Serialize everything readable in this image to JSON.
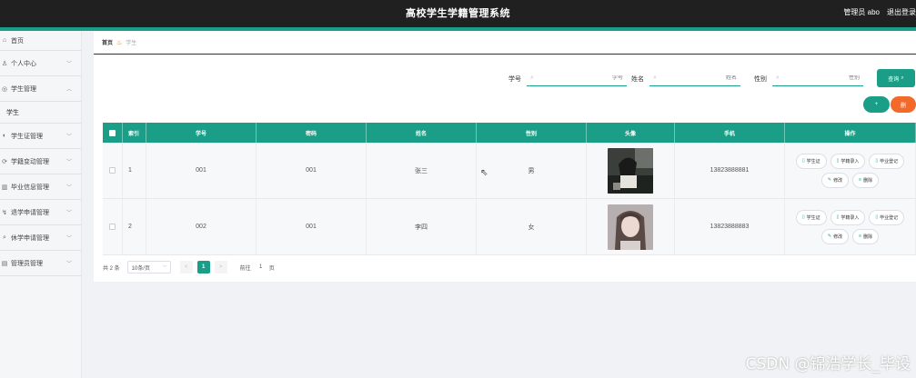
{
  "header": {
    "title": "高校学生学籍管理系统",
    "user": "管理员 abo",
    "logout": "退出登录"
  },
  "sidebar": {
    "items": [
      {
        "label": "首页",
        "icon": "home-icon"
      },
      {
        "label": "个人中心",
        "icon": "user-icon"
      },
      {
        "label": "学生管理",
        "icon": "student-icon",
        "expanded": true,
        "sub": [
          "学生"
        ]
      },
      {
        "label": "学生证管理",
        "icon": "card-icon"
      },
      {
        "label": "学籍变动管理",
        "icon": "change-icon"
      },
      {
        "label": "毕业信息管理",
        "icon": "graduate-icon"
      },
      {
        "label": "退学申请管理",
        "icon": "withdraw-icon"
      },
      {
        "label": "休学申请管理",
        "icon": "suspend-icon"
      },
      {
        "label": "管理员管理",
        "icon": "admin-icon"
      }
    ]
  },
  "breadcrumb": {
    "home": "首页",
    "current": "学生"
  },
  "search": {
    "xuehao_label": "学号",
    "xuehao_placeholder": "学号",
    "name_label": "姓名",
    "name_placeholder": "姓名",
    "sex_label": "性别",
    "sex_placeholder": "性别",
    "query_button": "查询"
  },
  "actions": {
    "add": "+",
    "delete": "删"
  },
  "table": {
    "columns": [
      "索引",
      "学号",
      "密码",
      "姓名",
      "性别",
      "头像",
      "手机",
      "操作"
    ],
    "rows": [
      {
        "index": "1",
        "xuehao": "001",
        "password": "001",
        "name": "张三",
        "sex": "男",
        "phone": "13823888881"
      },
      {
        "index": "2",
        "xuehao": "002",
        "password": "001",
        "name": "李四",
        "sex": "女",
        "phone": "13823888883"
      }
    ],
    "row_ops": [
      "学生证",
      "学籍录入",
      "毕业登记",
      "修改",
      "删除"
    ]
  },
  "pagination": {
    "total": "共 2 条",
    "page_size": "10条/页",
    "prev": "<",
    "current": "1",
    "next": ">",
    "goto": "前往",
    "goto_value": "1",
    "unit": "页"
  },
  "watermark": "CSDN @锦浩学长_毕设",
  "colors": {
    "primary": "#1b9e87",
    "danger": "#f2692a",
    "topbar": "#202020"
  }
}
